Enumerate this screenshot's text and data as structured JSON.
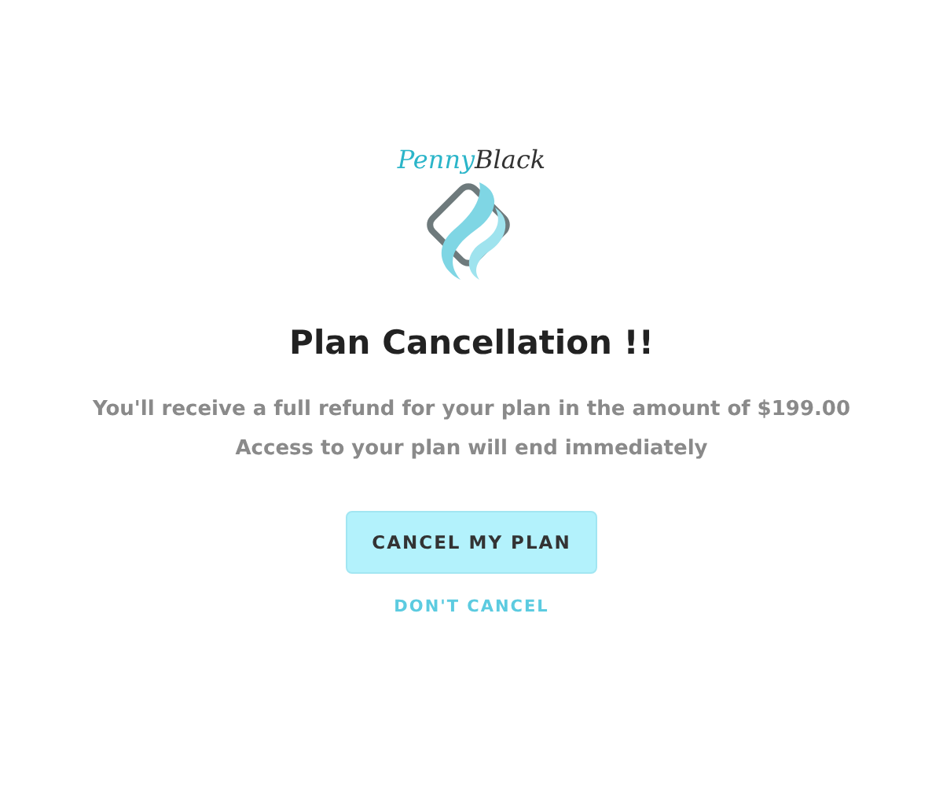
{
  "logo": {
    "first": "Penny",
    "second": "Black"
  },
  "title": "Plan Cancellation !!",
  "messages": [
    "You'll receive a full refund for your plan in the amount of $199.00",
    "Access to your plan will end immediately"
  ],
  "confirm_button": "CANCEL MY PLAN",
  "dismiss_link": "DON'T CANCEL"
}
